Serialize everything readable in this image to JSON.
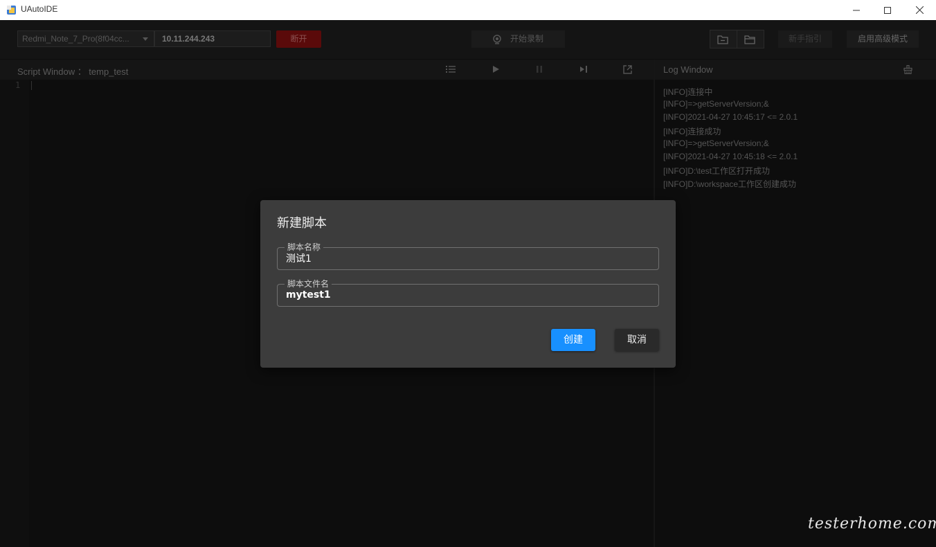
{
  "window": {
    "title": "UAutoIDE"
  },
  "toolbar": {
    "device_select": "Redmi_Note_7_Pro(8f04cc...",
    "ip_address": "10.11.244.243",
    "disconnect_label": "断开",
    "record_label": "开始录制",
    "guide_label": "新手指引",
    "advanced_label": "启用高级模式"
  },
  "script_window": {
    "title": "Script Window ： temp_test",
    "line_number": "1"
  },
  "log_window": {
    "title": "Log Window",
    "lines": [
      "[INFO]连接中",
      "[INFO]=>getServerVersion;&",
      "[INFO]2021-04-27 10:45:17 <= 2.0.1",
      "[INFO]连接成功",
      "[INFO]=>getServerVersion;&",
      "[INFO]2021-04-27 10:45:18 <= 2.0.1",
      "[INFO]D:\\test工作区打开成功",
      "[INFO]D:\\workspace工作区创建成功"
    ]
  },
  "dialog": {
    "title": "新建脚本",
    "name_label": "脚本名称",
    "name_value": "测试1",
    "file_label": "脚本文件名",
    "file_value": "mytest1",
    "create_label": "创建",
    "cancel_label": "取消"
  },
  "watermark": "testerhome.com",
  "colors": {
    "primary": "#1890ff",
    "disconnect": "#5a0a0a",
    "dialog_bg": "#3c3c3c",
    "app_bg": "#0d0d0d"
  }
}
